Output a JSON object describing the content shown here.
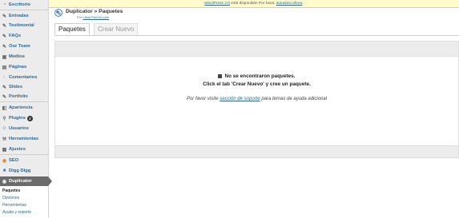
{
  "sidebar": {
    "items": [
      {
        "label": "Escritorio",
        "icon": "dashboard-icon"
      },
      {
        "label": "Entradas",
        "icon": "pin-icon"
      },
      {
        "label": "Testimonial",
        "icon": "pin-icon"
      },
      {
        "label": "FAQs",
        "icon": "pin-icon"
      },
      {
        "label": "Our Team",
        "icon": "pin-icon"
      },
      {
        "label": "Medios",
        "icon": "media-icon"
      },
      {
        "label": "Páginas",
        "icon": "pages-icon"
      },
      {
        "label": "Comentarios",
        "icon": "comments-icon"
      },
      {
        "label": "Slides",
        "icon": "pin-icon"
      },
      {
        "label": "Portfolio",
        "icon": "pin-icon"
      },
      {
        "label": "Apariencia",
        "icon": "appearance-icon"
      },
      {
        "label": "Plugins",
        "icon": "plugins-icon",
        "badge": "2"
      },
      {
        "label": "Usuarios",
        "icon": "users-icon"
      },
      {
        "label": "Herramientas",
        "icon": "tools-icon"
      },
      {
        "label": "Ajustes",
        "icon": "settings-icon"
      },
      {
        "label": "SEO",
        "icon": "seo-icon"
      },
      {
        "label": "Digg Digg",
        "icon": "digg-icon"
      },
      {
        "label": "Duplicator",
        "icon": "duplicator-icon",
        "active": true
      }
    ],
    "submenu": [
      {
        "label": "Paquetes",
        "current": true
      },
      {
        "label": "Opciones"
      },
      {
        "label": "Herramientas"
      },
      {
        "label": "Ayuda y soporte"
      }
    ]
  },
  "notice": {
    "link_version": "WordPress 4.0",
    "text_middle": " está disponible! Por favor, ",
    "link_update": "actualiza ahora",
    "text_end": "."
  },
  "header": {
    "title": "Duplicator » Paquetes",
    "subtitle_prefix": "Por",
    "subtitle_link": "LifeInTheGrid.com"
  },
  "tabs": [
    {
      "label": "Paquetes",
      "active": true
    },
    {
      "label": "Crear Nuevo",
      "active": false
    }
  ],
  "empty": {
    "line1": "No se encontraron paquetes.",
    "line2": "Click el tab 'Crear Nuevo' y cree un paquete.",
    "support_prefix": "Por favor visite ",
    "support_link": "sección de soporte",
    "support_suffix": " para temas de ayuda adicional"
  },
  "colors": {
    "link": "#2a6a9a",
    "sidebar_bg": "#ececec",
    "active_menu": "#6b6b6b",
    "notice_bg": "#fffbcc"
  }
}
